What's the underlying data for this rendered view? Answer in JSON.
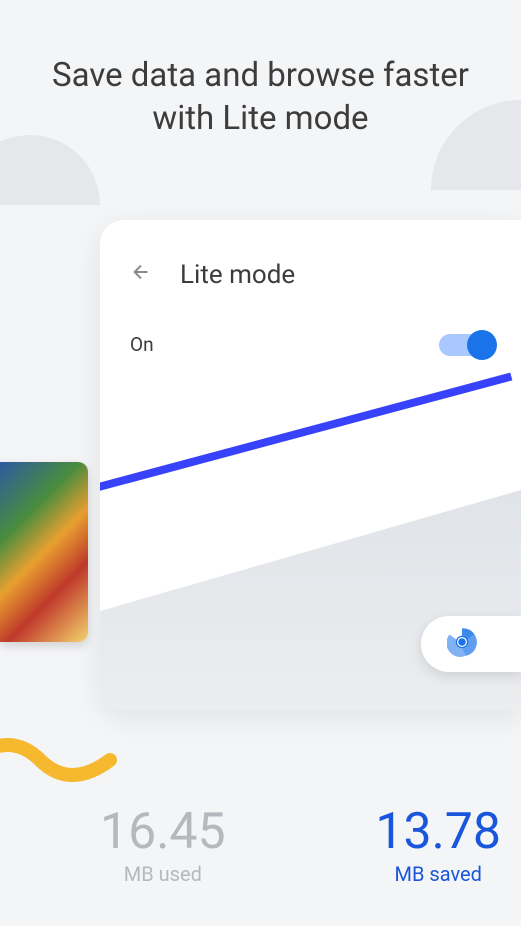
{
  "headline": "Save data and browse faster with Lite mode",
  "card": {
    "title": "Lite mode",
    "toggle_label": "On",
    "toggle_state": true
  },
  "stats": {
    "used_value": "16.45",
    "used_label": "MB used",
    "saved_value": "13.78",
    "saved_label": "MB saved"
  },
  "icons": {
    "back": "arrow-left-icon",
    "chrome": "chrome-icon"
  }
}
